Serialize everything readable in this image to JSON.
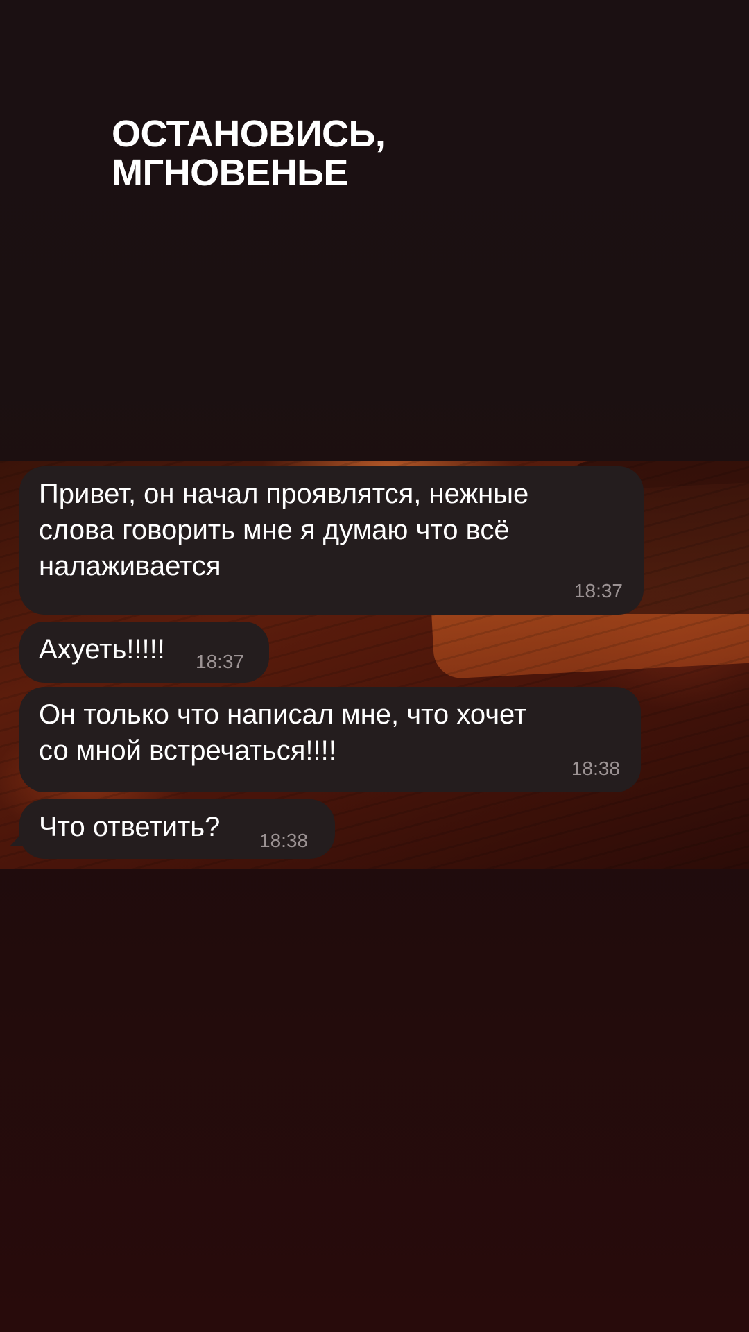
{
  "header": {
    "title_lines": [
      "ОСТАНОВИСЬ,",
      "МГНОВЕНЬЕ"
    ]
  },
  "chat": {
    "messages": [
      {
        "text": "Привет, он начал проявлятся, нежные\nслова говорить мне я думаю что всё\nналаживается",
        "time": "18:37"
      },
      {
        "text": "Ахуеть!!!!!",
        "time": "18:37"
      },
      {
        "text": "Он только что написал мне, что хочет\nсо мной встречаться!!!!",
        "time": "18:38"
      },
      {
        "text": "Что ответить?",
        "time": "18:38"
      }
    ]
  },
  "colors": {
    "background_top": "#1b1011",
    "background_bottom": "#280b0b",
    "bubble": "#241d1e",
    "message_text": "#ffffff",
    "timestamp_text": "#9c9394"
  }
}
